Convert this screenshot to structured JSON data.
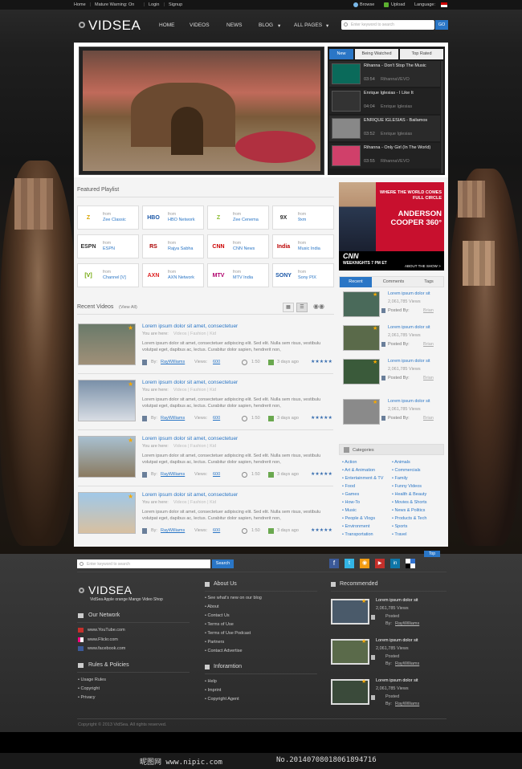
{
  "topbar": {
    "home": "Home",
    "warning": "Mature Warning: On",
    "login": "Login",
    "signup": "Signup",
    "browse": "Browse",
    "upload": "Upload",
    "language": "Language:"
  },
  "header": {
    "logo": "VIDSEA",
    "nav": [
      "HOME",
      "VIDEOS",
      "NEWS",
      "BLOG",
      "ALL PAGES"
    ],
    "search_placeholder": "Enter keyword to search",
    "search_button": "GO"
  },
  "player_tabs": [
    "New",
    "Being Watched",
    "Top Rated"
  ],
  "player_list": [
    {
      "title": "Rihanna - Don't Stop The Music",
      "time": "03:54",
      "author": "RihannaVEVO"
    },
    {
      "title": "Enrique Iglesias - I Like It",
      "time": "04:04",
      "author": "Enrique Iglesias"
    },
    {
      "title": "ENRIQUE IGLESIAS - Bailamos",
      "time": "03:52",
      "author": "Enrique Iglesias"
    },
    {
      "title": "Rihanna - Only Girl (In The World)",
      "time": "03:55",
      "author": "RihannaVEVO"
    }
  ],
  "featured": {
    "heading": "Featured Playlist",
    "from": "from",
    "items": [
      {
        "logo": "Z",
        "name": "Zee Classic",
        "color": "#d9a400"
      },
      {
        "logo": "HBO",
        "name": "HBO Network",
        "color": "#1b57a7"
      },
      {
        "logo": "Z",
        "name": "Zee Cenema",
        "color": "#8bbd2f"
      },
      {
        "logo": "9X",
        "name": "9xm",
        "color": "#333"
      },
      {
        "logo": "ESPN",
        "name": "ESPN",
        "color": "#333"
      },
      {
        "logo": "RS",
        "name": "Rajya Sabha",
        "color": "#a00"
      },
      {
        "logo": "CNN",
        "name": "CNN News",
        "color": "#cc0000"
      },
      {
        "logo": "India",
        "name": "Music India",
        "color": "#b00"
      },
      {
        "logo": "[V]",
        "name": "Channel [V]",
        "color": "#6da500"
      },
      {
        "logo": "AXN",
        "name": "AXN Network",
        "color": "#d22"
      },
      {
        "logo": "MTV",
        "name": "MTV India",
        "color": "#b0006b"
      },
      {
        "logo": "SONY",
        "name": "Sony PIX",
        "color": "#1b57a7"
      }
    ]
  },
  "recent": {
    "heading": "Recent Videos",
    "view_all": "(View All)",
    "title": "Lorem ipsum dolor sit amet, consectetuer",
    "here": "You are here:",
    "crumb": "Videos | Fashion | Kid",
    "desc": "Lorem ipsum dolor sit amet, consectetuer adipiscing elit. Sed elit. Nulla sem risus, vestibulu volutpat eget, dapibus ac, lectus. Curabitur dolor sapien, hendrerit non,",
    "by": "By:",
    "author": "RayWilliams",
    "views_label": "Views:",
    "views": "600",
    "duration": "1:50",
    "ago": "3 days ago",
    "stars": "★★★★★"
  },
  "ad": {
    "headline": "WHERE THE WORLD COMES FULL CIRCLE",
    "name": "ANDERSON COOPER 360°",
    "network": "CNN",
    "time": "WEEKNIGHTS 7 PM ET",
    "about": "ABOUT THE SHOW >"
  },
  "side_tabs": [
    "Recent",
    "Comments",
    "Tags"
  ],
  "side_items": {
    "title": "Lorem ipsum dolor sit",
    "views": "2,061,785 Views",
    "posted": "Posted By:",
    "author": "Brian"
  },
  "categories": {
    "heading": "Categories",
    "left": [
      "Action",
      "Art & Animation",
      "Entertainment & TV",
      "Food",
      "Games",
      "How-To",
      "Music",
      "People & Vlogs",
      "Environment",
      "Transportation"
    ],
    "right": [
      "Animals",
      "Commercials",
      "Family",
      "Funny Videos",
      "Health & Beauty",
      "Movies & Shorts",
      "News & Politics",
      "Products & Tech",
      "Sports",
      "Travel"
    ]
  },
  "footer": {
    "search_placeholder": "Enter keyword to search",
    "search_button": "Search",
    "top": "Top",
    "logo": "VIDSEA",
    "tagline": "VidSea Apple orange Mango Video Shop",
    "network_heading": "Our Network",
    "network": [
      "www.YouTube.com",
      "www.Flickr.com",
      "www.facebook.com"
    ],
    "rules_heading": "Rules & Policies",
    "rules": [
      "Usage Rules",
      "Copyright",
      "Privacy"
    ],
    "about_heading": "About Us",
    "about": [
      "See what's new on our blog",
      "About",
      "Contact Us",
      "Terms of Use",
      "Terms of Use Podcast",
      "Partners",
      "Contact Advertise"
    ],
    "info_heading": "Inforamtion",
    "info": [
      "Help",
      "Imprint",
      "Copyright Agent"
    ],
    "rec_heading": "Recommended",
    "rec_title": "Lorem ipsum dolor sit",
    "rec_views": "2,061,785 Views",
    "rec_posted": "Posted",
    "rec_by": "By:",
    "rec_author": "RayWilliams",
    "copyright": "Copyright © 2013 VidSea. All rights reserved."
  },
  "watermark": "昵图网 www.nipic.com",
  "stamp": "No.20140708018061894716"
}
